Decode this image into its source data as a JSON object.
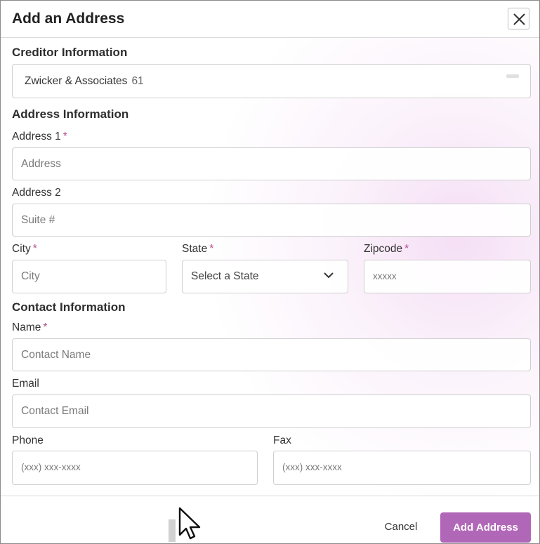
{
  "dialog": {
    "title": "Add an Address",
    "close_icon": "close-icon"
  },
  "creditor": {
    "section_title": "Creditor Information",
    "name": "Zwicker & Associates",
    "number": "61"
  },
  "address": {
    "section_title": "Address Information",
    "address1_label": "Address 1",
    "address1_placeholder": "Address",
    "address2_label": "Address 2",
    "address2_placeholder": "Suite #",
    "city_label": "City",
    "city_placeholder": "City",
    "state_label": "State",
    "state_value": "Select a State",
    "zip_label": "Zipcode",
    "zip_placeholder": "xxxxx",
    "required_mark": "*"
  },
  "contact": {
    "section_title": "Contact Information",
    "name_label": "Name",
    "name_placeholder": "Contact Name",
    "email_label": "Email",
    "email_placeholder": "Contact Email",
    "phone_label": "Phone",
    "phone_placeholder": "(xxx) xxx-xxxx",
    "fax_label": "Fax",
    "fax_placeholder": "(xxx) xxx-xxxx"
  },
  "footer": {
    "cancel_label": "Cancel",
    "submit_label": "Add Address"
  },
  "colors": {
    "accent": "#b167b8",
    "required": "#b24a8a"
  }
}
